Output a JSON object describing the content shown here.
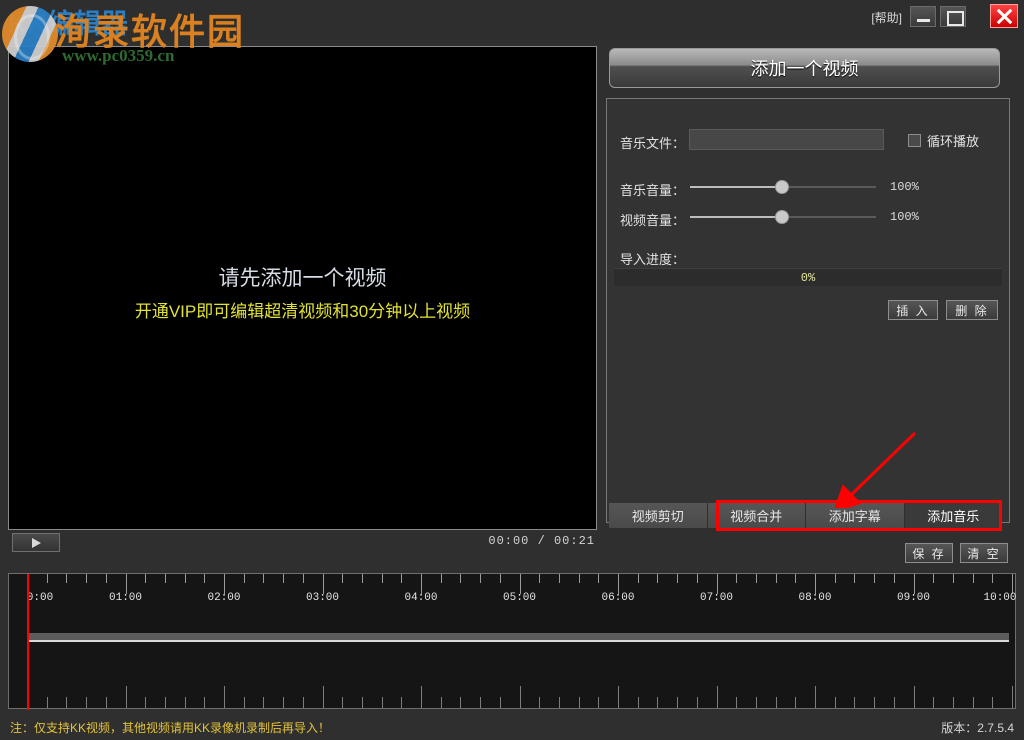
{
  "titlebar": {
    "app_title": "KK编辑器",
    "help_label": "[帮助]",
    "minimize_icon": "minimize-icon",
    "maximize_icon": "maximize-icon",
    "close_icon": "close-icon"
  },
  "watermark": {
    "text": "洵录软件园",
    "url": "www.pc0359.cn",
    "logo_icon": "globe-logo-icon"
  },
  "preview": {
    "placeholder_main": "请先添加一个视频",
    "placeholder_sub": "开通VIP即可编辑超清视频和30分钟以上视频"
  },
  "transport": {
    "play_icon": "play-icon",
    "time_readout": "00:00 / 00:21"
  },
  "panel": {
    "add_video_label": "添加一个视频",
    "music_file_label": "音乐文件：",
    "music_file_value": "",
    "music_file_placeholder": "",
    "loop_label": "循环播放",
    "loop_checked": false,
    "music_volume_label": "音乐音量：",
    "music_volume_value": "100%",
    "video_volume_label": "视频音量：",
    "video_volume_value": "100%",
    "progress_label": "导入进度：",
    "progress_value": "0%",
    "insert_label": "插 入",
    "delete_label": "删 除",
    "save_label": "保 存",
    "clear_label": "清 空"
  },
  "tabs": [
    {
      "label": "视频剪切",
      "active": false
    },
    {
      "label": "视频合并",
      "active": false
    },
    {
      "label": "添加字幕",
      "active": false
    },
    {
      "label": "添加音乐",
      "active": true
    }
  ],
  "annotation": {
    "highlight_color": "#ff0000",
    "arrow_icon": "red-arrow-icon"
  },
  "timeline": {
    "tick_labels": [
      "0:00",
      "01:00",
      "02:00",
      "03:00",
      "04:00",
      "05:00",
      "06:00",
      "07:00",
      "08:00",
      "09:00",
      "10:00"
    ],
    "playhead_position": "0:00"
  },
  "statusbar": {
    "note": "注：仅支持KK视频，其他视频请用KK录像机录制后再导入！",
    "version": "版本：2.7.5.4"
  }
}
